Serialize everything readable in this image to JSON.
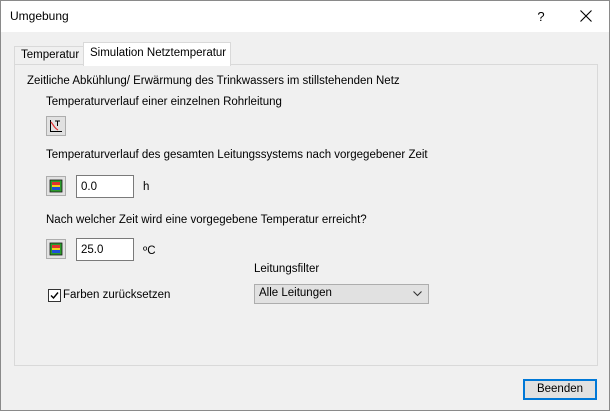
{
  "window": {
    "title": "Umgebung",
    "help_label": "?"
  },
  "tabs": [
    {
      "label": "Temperatur",
      "active": false
    },
    {
      "label": "Simulation Netztemperatur",
      "active": true
    }
  ],
  "panel": {
    "heading": "Zeitliche Abkühlung/ Erwärmung des Trinkwassers im stillstehenden Netz",
    "single_pipe_label": "Temperaturverlauf einer einzelnen Rohrleitung",
    "system_label": "Temperaturverlauf des gesamten Leitungssystems nach vorgegebener Zeit",
    "time_value": "0.0",
    "time_unit": "h",
    "target_label": "Nach welcher Zeit wird eine vorgegebene Temperatur erreicht?",
    "temp_value": "25.0",
    "temp_unit": "ºC",
    "reset_colors_label": "Farben zurücksetzen",
    "reset_colors_checked": true,
    "filter_label": "Leitungsfilter",
    "filter_value": "Alle Leitungen"
  },
  "footer": {
    "close_label": "Beenden"
  },
  "icons": {
    "graph": "temperature-graph-icon",
    "network_a": "network-color-icon",
    "network_b": "network-color-icon",
    "close": "close-icon",
    "check": "checkmark-icon",
    "dropdown": "chevron-down-icon"
  },
  "colors": {
    "accent": "#0078d7",
    "icon_red": "#e03030",
    "icon_green": "#2c9b2c",
    "icon_blue": "#1d4fd8",
    "icon_yellow": "#f2d21a"
  }
}
